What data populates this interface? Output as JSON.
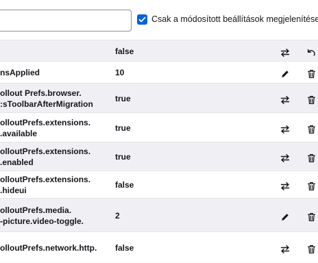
{
  "search": {
    "value": "",
    "placeholder": ""
  },
  "filter_checkbox": {
    "checked": true,
    "label": "Csak a módosított beállítások megjelenítése"
  },
  "rows": [
    {
      "name": "",
      "value": "false",
      "action": "toggle-icon",
      "extra": "reset-icon"
    },
    {
      "name": "nsApplied",
      "value": "10",
      "action": "edit-icon",
      "extra": "trash-icon"
    },
    {
      "name": "ollout Prefs.browser.\n:sToolbarAfterMigration",
      "value": "true",
      "action": "toggle-icon",
      "extra": "trash-icon"
    },
    {
      "name": "olloutPrefs.extensions.\n.available",
      "value": "true",
      "action": "toggle-icon",
      "extra": "trash-icon"
    },
    {
      "name": "olloutPrefs.extensions.\n.enabled",
      "value": "true",
      "action": "toggle-icon",
      "extra": "trash-icon"
    },
    {
      "name": "olloutPrefs.extensions.\n.hideui",
      "value": "false",
      "action": "toggle-icon",
      "extra": "trash-icon"
    },
    {
      "name": "olloutPrefs.media.\n-picture.video-toggle.",
      "value": "2",
      "action": "edit-icon",
      "extra": "trash-icon"
    },
    {
      "name": "olloutPrefs.network.http.",
      "value": "false",
      "action": "toggle-icon",
      "extra": "trash-icon"
    }
  ]
}
